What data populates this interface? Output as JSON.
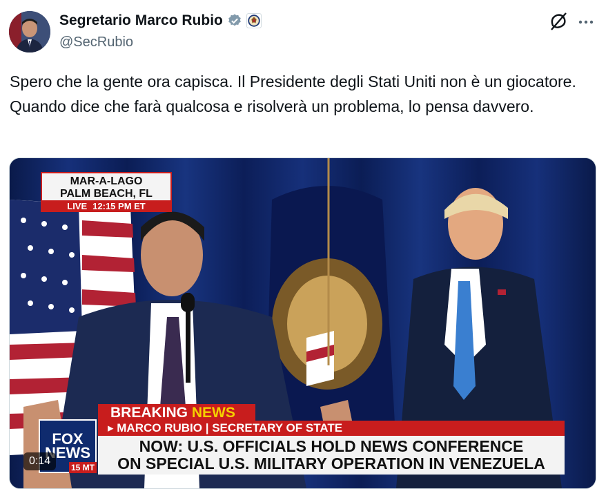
{
  "author": {
    "display_name": "Segretario Marco Rubio",
    "handle": "@SecRubio"
  },
  "icons": {
    "verified": "verified-badge-icon",
    "affiliation": "state-department-seal-icon",
    "grok": "grok-icon",
    "more": "more-options-icon"
  },
  "tweet": {
    "text": "Spero che la gente ora capisca. Il Presidente degli Stati Uniti non è un giocatore. Quando dice che farà qualcosa e risolverà un problema, lo pensa davvero."
  },
  "video": {
    "location_line1": "MAR-A-LAGO",
    "location_line2": "PALM BEACH, FL",
    "live_label": "LIVE",
    "live_time": "12:15 PM ET",
    "breaking_label": "BREAKING",
    "news_label": "NEWS",
    "speaker_name": "MARCO RUBIO",
    "speaker_title": "SECRETARY OF STATE",
    "headline_line1": "NOW: U.S. OFFICIALS HOLD NEWS CONFERENCE",
    "headline_line2": "ON SPECIAL U.S. MILITARY OPERATION IN VENEZUELA",
    "logo_line1": "FOX",
    "logo_line2": "NEWS",
    "time_bug": "15 MT",
    "timestamp": "0:14"
  },
  "colors": {
    "fox_red": "#c81d1d",
    "fox_blue": "#0f2b6e",
    "verified_blue": "#829aab"
  }
}
